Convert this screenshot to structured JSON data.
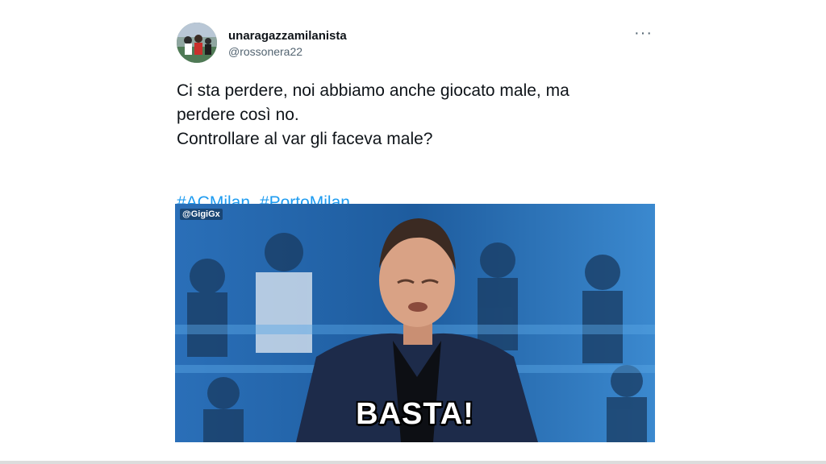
{
  "tweet": {
    "display_name": "unaragazzamilanista",
    "handle": "@rossonera22",
    "more_label": "···",
    "text_lines": [
      "Ci sta perdere, noi abbiamo anche giocato male, ma",
      "perdere così no.",
      "Controllare al var gli faceva male?"
    ],
    "hashtags": [
      "#ACMilan",
      "#PortoMilan"
    ]
  },
  "media": {
    "watermark": "@GigiGx",
    "caption": "BASTA!"
  },
  "colors": {
    "link": "#1d9bf0",
    "secondary_text": "#536471"
  }
}
